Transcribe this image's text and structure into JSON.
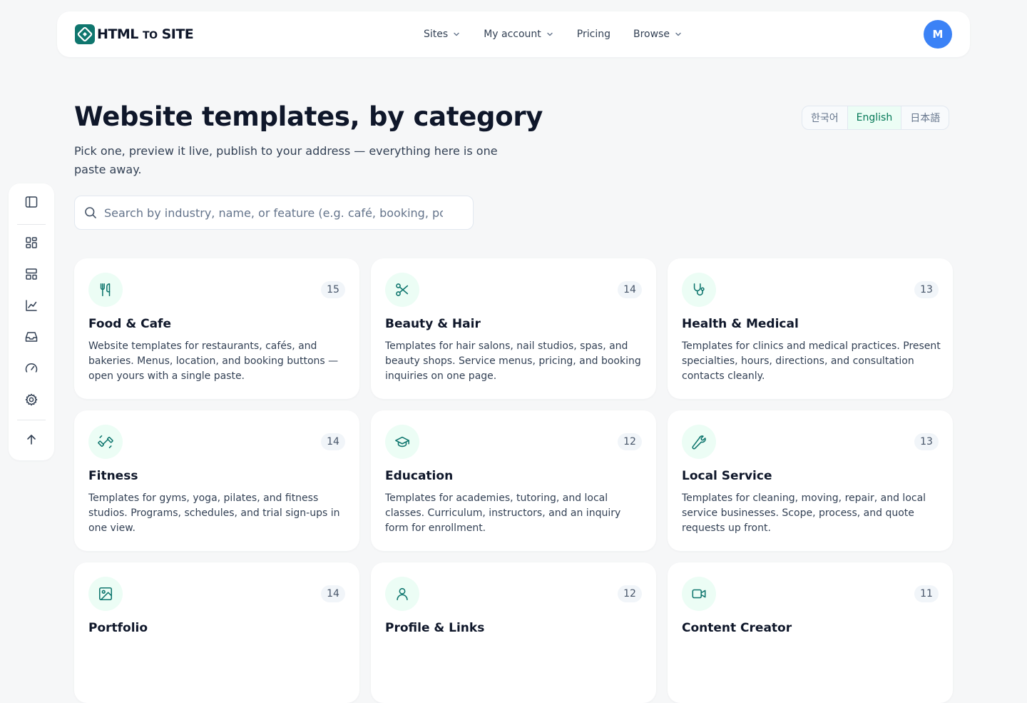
{
  "brand": {
    "name_main": "HTML",
    "name_small": "TO",
    "name_end": "SITE",
    "accent": "#0f766e"
  },
  "nav": [
    {
      "label": "Sites",
      "has_dropdown": true
    },
    {
      "label": "My account",
      "has_dropdown": true
    },
    {
      "label": "Pricing",
      "has_dropdown": false
    },
    {
      "label": "Browse",
      "has_dropdown": true
    }
  ],
  "user": {
    "initial": "M",
    "avatar_color": "#3b82f6"
  },
  "sidebar_icons": [
    "panel-toggle-icon",
    "dashboard-icon",
    "layout-icon",
    "chart-icon",
    "inbox-icon",
    "gauge-icon",
    "settings-icon",
    "arrow-up-icon"
  ],
  "page": {
    "title": "Website templates, by category",
    "subtitle": "Pick one, preview it live, publish to your address — everything here is one paste away."
  },
  "languages": [
    {
      "label": "한국어",
      "active": false
    },
    {
      "label": "English",
      "active": true
    },
    {
      "label": "日本語",
      "active": false
    }
  ],
  "search": {
    "placeholder": "Search by industry, name, or feature (e.g. café, booking, portfolio)",
    "value": ""
  },
  "categories": [
    {
      "icon": "utensils-icon",
      "title": "Food & Cafe",
      "count": "15",
      "description": "Website templates for restaurants, cafés, and bakeries. Menus, location, and booking buttons — open yours with a single paste."
    },
    {
      "icon": "scissors-icon",
      "title": "Beauty & Hair",
      "count": "14",
      "description": "Templates for hair salons, nail studios, spas, and beauty shops. Service menus, pricing, and booking inquiries on one page."
    },
    {
      "icon": "stethoscope-icon",
      "title": "Health & Medical",
      "count": "13",
      "description": "Templates for clinics and medical practices. Present specialties, hours, directions, and consultation contacts cleanly."
    },
    {
      "icon": "dumbbell-icon",
      "title": "Fitness",
      "count": "14",
      "description": "Templates for gyms, yoga, pilates, and fitness studios. Programs, schedules, and trial sign-ups in one view."
    },
    {
      "icon": "graduation-cap-icon",
      "title": "Education",
      "count": "12",
      "description": "Templates for academies, tutoring, and local classes. Curriculum, instructors, and an inquiry form for enrollment."
    },
    {
      "icon": "wrench-icon",
      "title": "Local Service",
      "count": "13",
      "description": "Templates for cleaning, moving, repair, and local service businesses. Scope, process, and quote requests up front."
    },
    {
      "icon": "image-icon",
      "title": "Portfolio",
      "count": "14",
      "description": ""
    },
    {
      "icon": "user-icon",
      "title": "Profile & Links",
      "count": "12",
      "description": ""
    },
    {
      "icon": "video-icon",
      "title": "Content Creator",
      "count": "11",
      "description": ""
    }
  ]
}
